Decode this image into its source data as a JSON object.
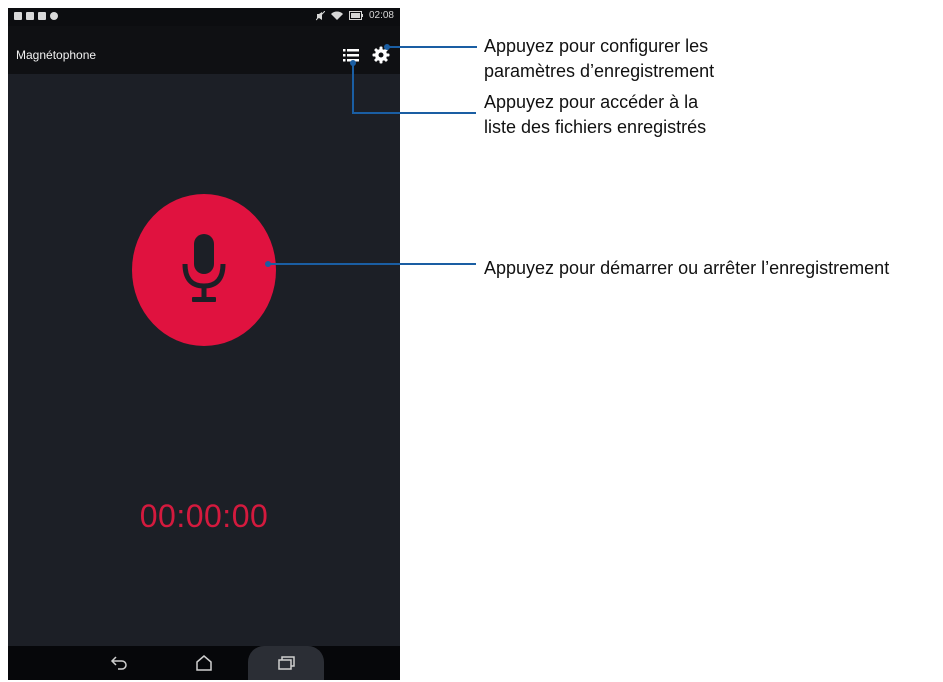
{
  "status_bar": {
    "time": "02:08"
  },
  "app_bar": {
    "title": "Magnétophone",
    "list_icon": "list-icon",
    "settings_icon": "gear-icon"
  },
  "recorder": {
    "mic_icon": "microphone-icon",
    "timer": "00:00:00",
    "button_color": "#e0123f",
    "timer_color": "#d41a3e"
  },
  "nav_bar": {
    "back_icon": "back-icon",
    "home_icon": "home-icon",
    "recent_icon": "recent-apps-icon"
  },
  "annotations": {
    "settings": [
      "Appuyez pour configurer les",
      "paramètres d’enregistrement"
    ],
    "list": [
      "Appuyez pour accéder à la",
      "liste des fichiers enregistrés"
    ],
    "record": "Appuyez pour démarrer ou arrêter l’enregistrement",
    "line_color": "#1a5ea3"
  }
}
